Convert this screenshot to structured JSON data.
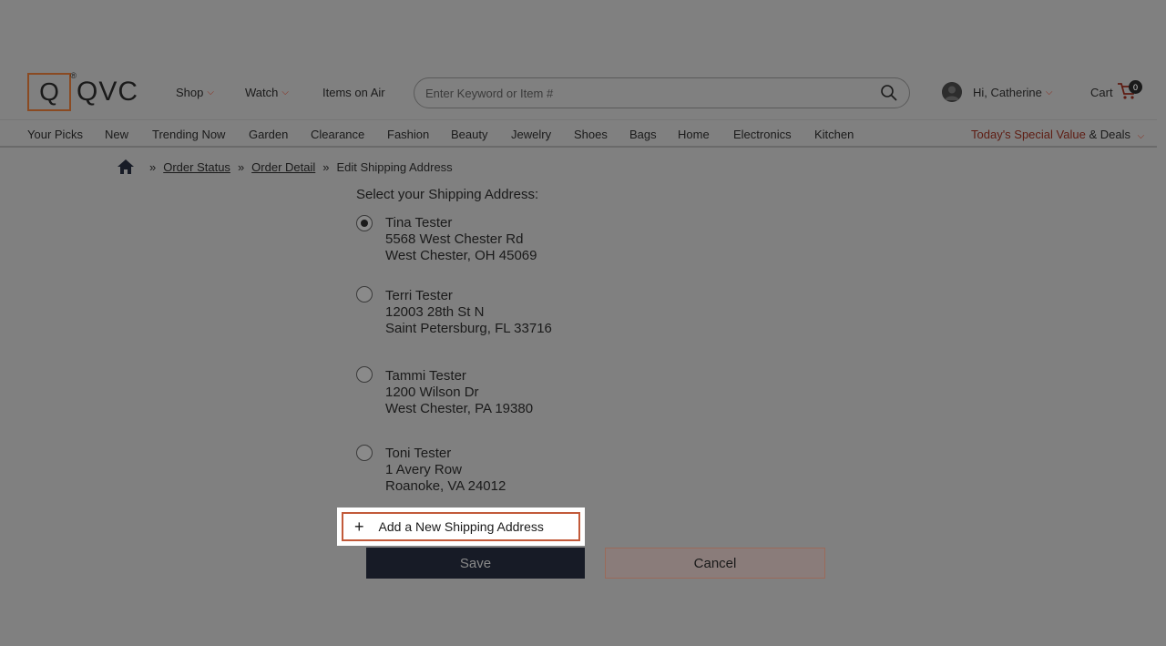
{
  "brand": {
    "logo_letter": "Q",
    "logo_text": "QVC"
  },
  "topnav": {
    "shop": "Shop",
    "watch": "Watch",
    "items_on_air": "Items on Air"
  },
  "search": {
    "placeholder": "Enter Keyword or Item #"
  },
  "account": {
    "greeting": "Hi, Catherine"
  },
  "cart": {
    "label": "Cart",
    "count": "0"
  },
  "categories": [
    "Your Picks",
    "New",
    "Trending Now",
    "Garden",
    "Clearance",
    "Fashion",
    "Beauty",
    "Jewelry",
    "Shoes",
    "Bags",
    "Home",
    "Electronics",
    "Kitchen"
  ],
  "deals": {
    "label": "Today's Special Value",
    "suffix": "& Deals"
  },
  "breadcrumb": {
    "sep": "»",
    "order_status": "Order Status",
    "order_detail": "Order Detail",
    "current": "Edit Shipping Address"
  },
  "form": {
    "title": "Select your Shipping Address:",
    "addresses": [
      {
        "name": "Tina Tester",
        "street": "5568 West Chester Rd",
        "city": "West Chester, OH 45069",
        "selected": true
      },
      {
        "name": "Terri Tester",
        "street": "12003 28th St N",
        "city": "Saint Petersburg, FL 33716",
        "selected": false
      },
      {
        "name": "Tammi Tester",
        "street": "1200 Wilson Dr",
        "city": "West Chester, PA 19380",
        "selected": false
      },
      {
        "name": "Toni Tester",
        "street": "1 Avery Row",
        "city": "Roanoke, VA 24012",
        "selected": false
      }
    ],
    "add_new": "Add a New Shipping Address",
    "save": "Save",
    "cancel": "Cancel"
  },
  "colors": {
    "overlay": "#808080",
    "accent": "#8b2a1a",
    "highlight_border": "#c25a3a",
    "save_bg": "#171b26"
  }
}
